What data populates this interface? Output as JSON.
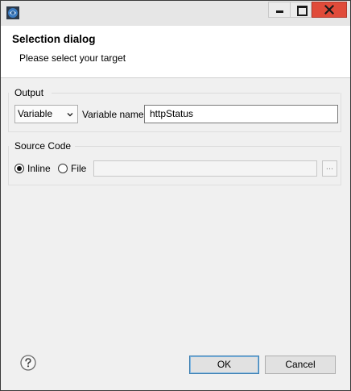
{
  "titlebar": {
    "app_icon": "eclipse-app-icon",
    "minimize_icon": "minimize-icon",
    "maximize_icon": "maximize-icon",
    "close_icon": "close-icon"
  },
  "header": {
    "title": "Selection dialog",
    "subtitle": "Please select your target"
  },
  "output": {
    "group_label": "Output",
    "type_selected": "Variable",
    "variable_name_label": "Variable name",
    "variable_name_value": "httpStatus"
  },
  "source_code": {
    "group_label": "Source Code",
    "inline_label": "Inline",
    "file_label": "File",
    "selected": "Inline",
    "file_path_value": "",
    "browse_label": "..."
  },
  "footer": {
    "help_icon": "help-icon",
    "ok_label": "OK",
    "cancel_label": "Cancel"
  },
  "colors": {
    "close_button": "#e04b3a",
    "ok_border": "#3c7fb1"
  }
}
